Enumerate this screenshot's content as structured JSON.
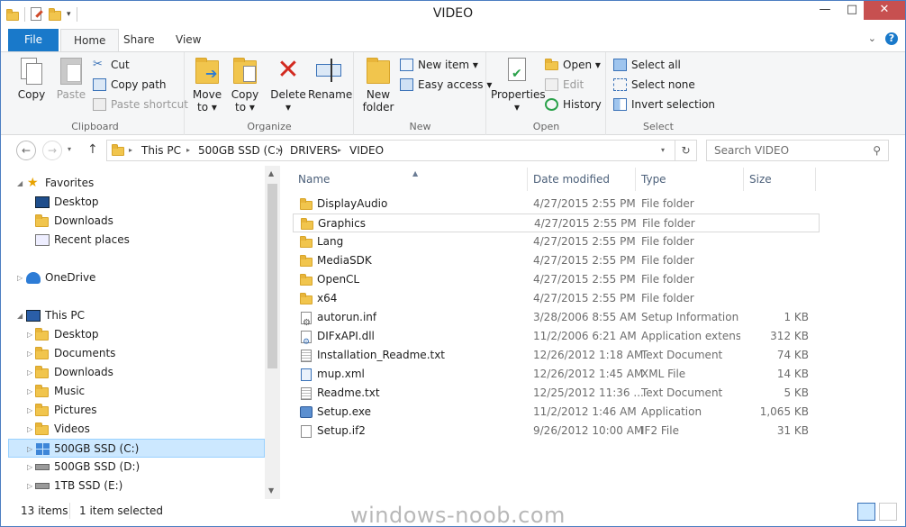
{
  "window": {
    "title": "VIDEO"
  },
  "ribbon_tabs": {
    "file": "File",
    "home": "Home",
    "share": "Share",
    "view": "View"
  },
  "ribbon": {
    "clipboard": {
      "label": "Clipboard",
      "copy": "Copy",
      "paste": "Paste",
      "cut": "Cut",
      "copy_path": "Copy path",
      "paste_shortcut": "Paste shortcut"
    },
    "organize": {
      "label": "Organize",
      "move_to": "Move",
      "move_to2": "to ▾",
      "copy_to": "Copy",
      "copy_to2": "to ▾",
      "delete": "Delete",
      "delete2": "▾",
      "rename": "Rename"
    },
    "new": {
      "label": "New",
      "new_folder": "New",
      "new_folder2": "folder",
      "new_item": "New item ▾",
      "easy_access": "Easy access ▾"
    },
    "open": {
      "label": "Open",
      "properties": "Properties",
      "properties2": "▾",
      "open": "Open ▾",
      "edit": "Edit",
      "history": "History"
    },
    "select": {
      "label": "Select",
      "select_all": "Select all",
      "select_none": "Select none",
      "invert": "Invert selection"
    }
  },
  "address": {
    "crumbs": [
      "This PC",
      "500GB SSD (C:)",
      "DRIVERS",
      "VIDEO"
    ],
    "search_placeholder": "Search VIDEO"
  },
  "nav": {
    "favorites": "Favorites",
    "fav_items": [
      "Desktop",
      "Downloads",
      "Recent places"
    ],
    "onedrive": "OneDrive",
    "this_pc": "This PC",
    "pc_items": [
      "Desktop",
      "Documents",
      "Downloads",
      "Music",
      "Pictures",
      "Videos",
      "500GB SSD (C:)",
      "500GB SSD (D:)",
      "1TB SSD (E:)"
    ]
  },
  "columns": {
    "name": "Name",
    "date": "Date modified",
    "type": "Type",
    "size": "Size"
  },
  "files": [
    {
      "name": "DisplayAudio",
      "date": "4/27/2015 2:55 PM",
      "type": "File folder",
      "size": "",
      "icon": "folder"
    },
    {
      "name": "Graphics",
      "date": "4/27/2015 2:55 PM",
      "type": "File folder",
      "size": "",
      "icon": "folder"
    },
    {
      "name": "Lang",
      "date": "4/27/2015 2:55 PM",
      "type": "File folder",
      "size": "",
      "icon": "folder"
    },
    {
      "name": "MediaSDK",
      "date": "4/27/2015 2:55 PM",
      "type": "File folder",
      "size": "",
      "icon": "folder"
    },
    {
      "name": "OpenCL",
      "date": "4/27/2015 2:55 PM",
      "type": "File folder",
      "size": "",
      "icon": "folder"
    },
    {
      "name": "x64",
      "date": "4/27/2015 2:55 PM",
      "type": "File folder",
      "size": "",
      "icon": "folder"
    },
    {
      "name": "autorun.inf",
      "date": "3/28/2006 8:55 AM",
      "type": "Setup Information",
      "size": "1 KB",
      "icon": "gear-doc"
    },
    {
      "name": "DIFxAPI.dll",
      "date": "11/2/2006 6:21 AM",
      "type": "Application extens...",
      "size": "312 KB",
      "icon": "dll-doc"
    },
    {
      "name": "Installation_Readme.txt",
      "date": "12/26/2012 1:18 AM",
      "type": "Text Document",
      "size": "74 KB",
      "icon": "text-doc"
    },
    {
      "name": "mup.xml",
      "date": "12/26/2012 1:45 AM",
      "type": "XML File",
      "size": "14 KB",
      "icon": "xml-doc"
    },
    {
      "name": "Readme.txt",
      "date": "12/25/2012 11:36 ...",
      "type": "Text Document",
      "size": "5 KB",
      "icon": "text-doc"
    },
    {
      "name": "Setup.exe",
      "date": "11/2/2012 1:46 AM",
      "type": "Application",
      "size": "1,065 KB",
      "icon": "exe"
    },
    {
      "name": "Setup.if2",
      "date": "9/26/2012 10:00 AM",
      "type": "IF2 File",
      "size": "31 KB",
      "icon": "blank-doc"
    }
  ],
  "status": {
    "count": "13 items",
    "selected": "1 item selected"
  },
  "watermark": "windows-noob.com",
  "colors": {
    "accent": "#1979ca",
    "selection": "#cce8ff",
    "close": "#c75050"
  }
}
